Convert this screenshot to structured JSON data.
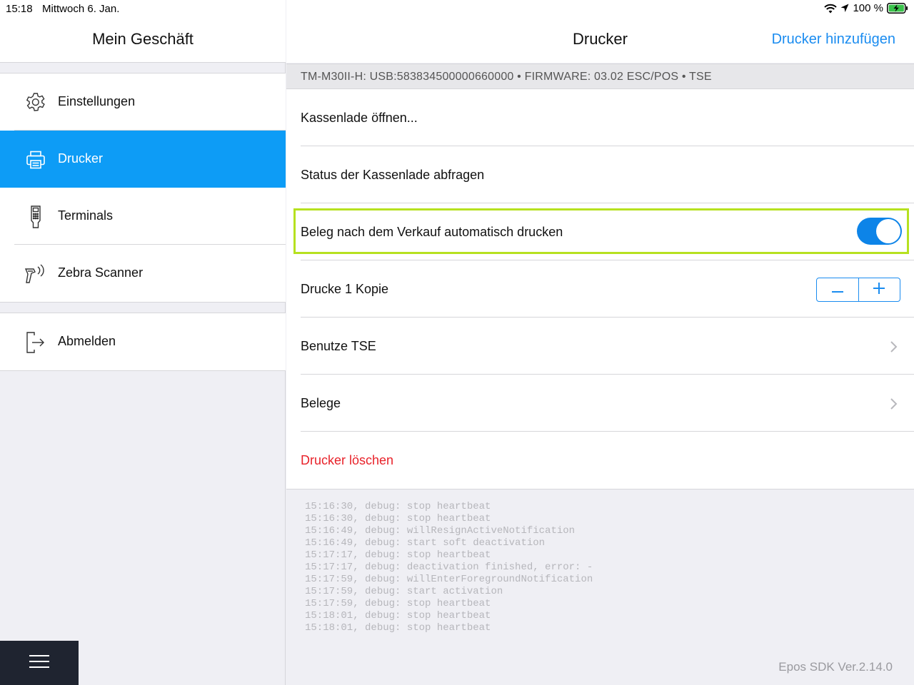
{
  "status_bar": {
    "time": "15:18",
    "date": "Mittwoch 6. Jan.",
    "battery_label": "100 %",
    "icons": [
      "wifi-icon",
      "location-arrow-icon",
      "battery-charging-icon"
    ]
  },
  "sidebar": {
    "title": "Mein Geschäft",
    "items": [
      {
        "label": "Einstellungen",
        "icon": "gear-icon"
      },
      {
        "label": "Drucker",
        "icon": "printer-icon",
        "active": true
      },
      {
        "label": "Terminals",
        "icon": "payment-terminal-icon"
      },
      {
        "label": "Zebra Scanner",
        "icon": "barcode-scanner-icon"
      }
    ],
    "logout": {
      "label": "Abmelden",
      "icon": "logout-icon"
    },
    "menu_icon": "hamburger-menu-icon"
  },
  "nav": {
    "title": "Drucker",
    "action": "Drucker hinzufügen"
  },
  "printer": {
    "info": "TM-M30II-H: USB:583834500000660000 • FIRMWARE: 03.02 ESC/POS • TSE",
    "rows": {
      "open_drawer": "Kassenlade öffnen...",
      "drawer_status": "Status der Kassenlade abfragen",
      "auto_print": "Beleg nach dem Verkauf automatisch drucken",
      "copies": "Drucke 1 Kopie",
      "use_tse": "Benutze TSE",
      "receipts": "Belege",
      "delete": "Drucker löschen"
    },
    "auto_print_enabled": true,
    "stepper": {
      "minus": "minus-icon",
      "plus": "plus-icon"
    }
  },
  "log": [
    "15:16:30, debug: stop heartbeat",
    "15:16:30, debug: stop heartbeat",
    "15:16:49, debug: willResignActiveNotification",
    "15:16:49, debug: start soft deactivation",
    "15:17:17, debug: stop heartbeat",
    "15:17:17, debug: deactivation finished, error: -",
    "15:17:59, debug: willEnterForegroundNotification",
    "15:17:59, debug: start activation",
    "15:17:59, debug: stop heartbeat",
    "15:18:01, debug: stop heartbeat",
    "15:18:01, debug: stop heartbeat"
  ],
  "footer": "Epos SDK Ver.2.14.0",
  "colors": {
    "accent": "#0d9cf6",
    "link": "#1a8cf0",
    "danger": "#e8222a",
    "highlight": "#b6e11f",
    "toggle_on": "#0d84e8",
    "menu_button_bg": "#1f2430"
  }
}
